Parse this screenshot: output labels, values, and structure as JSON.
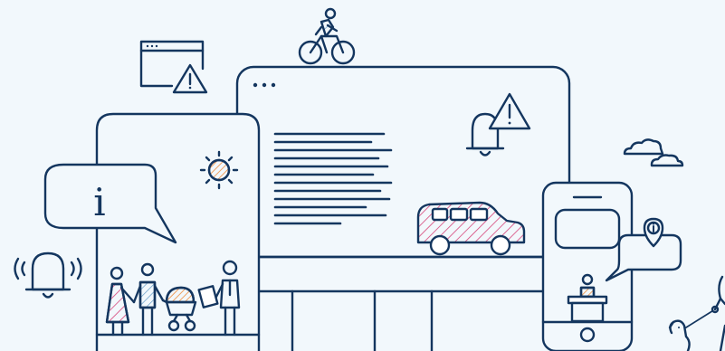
{
  "palette": {
    "background": "#f2f8fc",
    "line": "#14365f",
    "accent_pink": "#d6457a",
    "accent_orange": "#ef8b3a",
    "accent_blue": "#6a9fc9",
    "fill_white": "#ffffff"
  },
  "icons": [
    "cyclist-icon",
    "browser-warning-icon",
    "warning-triangle-icon",
    "bell-alert-icon",
    "info-bubble-icon",
    "sun-icon",
    "ringing-bell-icon",
    "family-icon",
    "stroller-icon",
    "car-icon",
    "cloud-icon",
    "location-pin-info-icon",
    "desk-person-icon",
    "dog-icon"
  ],
  "info_glyph": "i"
}
